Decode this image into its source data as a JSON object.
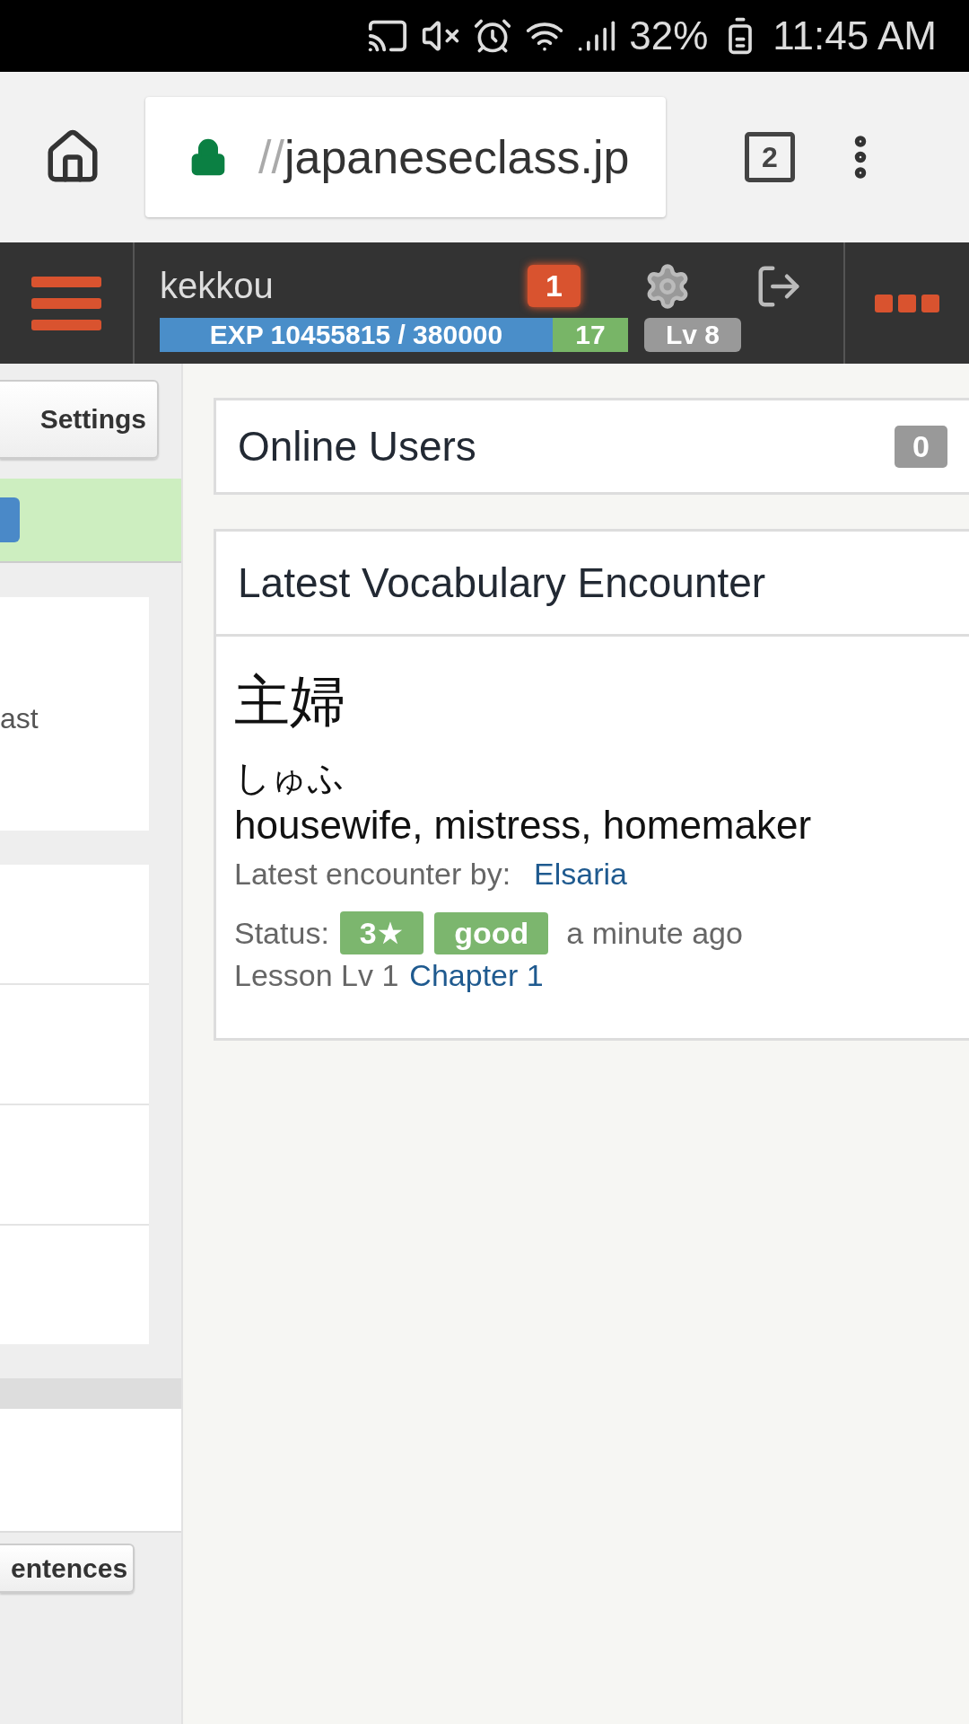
{
  "status_bar": {
    "battery": "32%",
    "time": "11:45 AM"
  },
  "browser": {
    "url_prefix": "//",
    "url_host": "japaneseclass.jp",
    "tab_count": "2"
  },
  "nav": {
    "username": "kekkou",
    "notification_count": "1",
    "exp": "EXP 10455815 / 380000",
    "streak": "17",
    "level": "Lv 8"
  },
  "left_column": {
    "settings_button": "Settings",
    "panel_text": "ast",
    "sentences_button": "entences"
  },
  "online_users": {
    "title": "Online Users",
    "count": "0"
  },
  "vocab": {
    "title": "Latest Vocabulary Encounter",
    "word": "主婦",
    "reading": "しゅふ",
    "meaning": "housewife, mistress, homemaker",
    "encounter_label": "Latest encounter by:",
    "encounter_user": "Elsaria",
    "status_label": "Status:",
    "tags": [
      {
        "label": "3★",
        "color": "#7cb66e"
      },
      {
        "label": "good",
        "color": "#7cb66e"
      }
    ],
    "time_ago": "a minute ago",
    "lesson": "Lesson Lv 1",
    "chapter": "Chapter 1"
  }
}
